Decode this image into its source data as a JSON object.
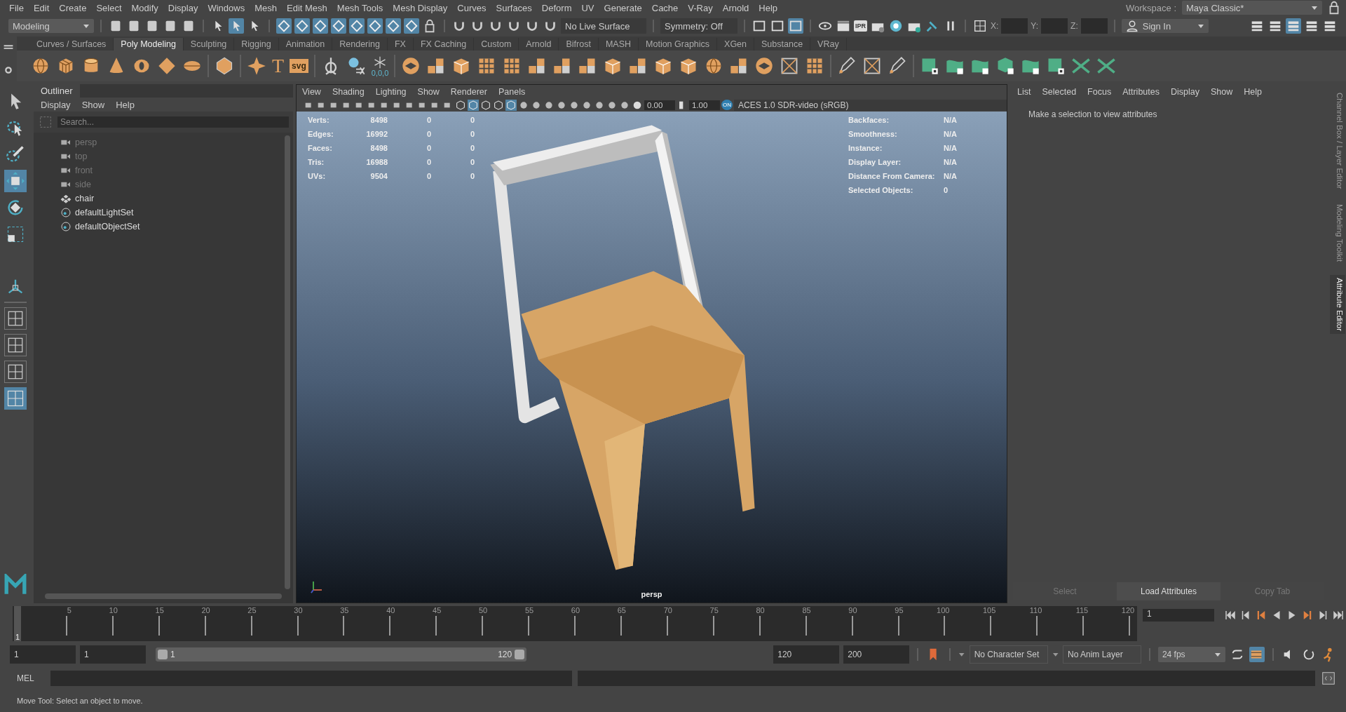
{
  "menu_bar": [
    "File",
    "Edit",
    "Create",
    "Select",
    "Modify",
    "Display",
    "Windows",
    "Mesh",
    "Edit Mesh",
    "Mesh Tools",
    "Mesh Display",
    "Curves",
    "Surfaces",
    "Deform",
    "UV",
    "Generate",
    "Cache",
    "V-Ray",
    "Arnold",
    "Help"
  ],
  "workspace": {
    "label": "Workspace :",
    "value": "Maya Classic*"
  },
  "status_line": {
    "mode": "Modeling",
    "select_modes": [
      {
        "selected": false
      },
      {
        "selected": true
      },
      {
        "selected": false
      }
    ],
    "mask_buttons": [
      {
        "on": true
      },
      {
        "on": true
      },
      {
        "on": true
      },
      {
        "on": true
      },
      {
        "on": true
      },
      {
        "on": true
      },
      {
        "on": true
      },
      {
        "on": true
      }
    ],
    "live_surface": "No Live Surface",
    "symmetry": "Symmetry: Off",
    "panel_toggles": [
      {
        "selected": false
      },
      {
        "selected": false
      },
      {
        "selected": true
      }
    ],
    "ipr_label": "IPR",
    "x_label": "X:",
    "y_label": "Y:",
    "z_label": "Z:",
    "sign_in": "Sign In",
    "layout_toggles": [
      {
        "selected": false
      },
      {
        "selected": false
      },
      {
        "selected": true
      },
      {
        "selected": false
      },
      {
        "selected": false
      }
    ]
  },
  "shelf": {
    "tabs": [
      {
        "label": "Curves / Surfaces",
        "selected": false
      },
      {
        "label": "Poly Modeling",
        "selected": true
      },
      {
        "label": "Sculpting",
        "selected": false
      },
      {
        "label": "Rigging",
        "selected": false
      },
      {
        "label": "Animation",
        "selected": false
      },
      {
        "label": "Rendering",
        "selected": false
      },
      {
        "label": "FX",
        "selected": false
      },
      {
        "label": "FX Caching",
        "selected": false
      },
      {
        "label": "Custom",
        "selected": false
      },
      {
        "label": "Arnold",
        "selected": false
      },
      {
        "label": "Bifrost",
        "selected": false
      },
      {
        "label": "MASH",
        "selected": false
      },
      {
        "label": "Motion Graphics",
        "selected": false
      },
      {
        "label": "XGen",
        "selected": false
      },
      {
        "label": "Substance",
        "selected": false
      },
      {
        "label": "VRay",
        "selected": false
      }
    ],
    "text_tool_glyph": "T",
    "svg_tool_label": "svg",
    "snap_values": "0,0,0"
  },
  "toolbox": {
    "tools": [
      {
        "selected": false
      },
      {
        "selected": false
      },
      {
        "selected": false
      },
      {
        "selected": true
      },
      {
        "selected": false
      },
      {
        "selected": false
      }
    ],
    "layouts": [
      {
        "selected": false
      },
      {
        "selected": false
      },
      {
        "selected": false
      },
      {
        "selected": true
      }
    ]
  },
  "outliner": {
    "title": "Outliner",
    "menu": [
      "Display",
      "Show",
      "Help"
    ],
    "search": {
      "placeholder": "Search..."
    },
    "items": [
      {
        "label": "persp",
        "kind": "camera",
        "dimmed": true
      },
      {
        "label": "top",
        "kind": "camera",
        "dimmed": true
      },
      {
        "label": "front",
        "kind": "camera",
        "dimmed": true
      },
      {
        "label": "side",
        "kind": "camera",
        "dimmed": true
      },
      {
        "label": "chair",
        "kind": "mesh",
        "dimmed": false
      },
      {
        "label": "defaultLightSet",
        "kind": "set",
        "dimmed": false
      },
      {
        "label": "defaultObjectSet",
        "kind": "set",
        "dimmed": false
      }
    ]
  },
  "viewport": {
    "menu": [
      "View",
      "Shading",
      "Lighting",
      "Show",
      "Renderer",
      "Panels"
    ],
    "shading_buttons": [
      {
        "selected": false
      },
      {
        "selected": true
      },
      {
        "selected": false
      },
      {
        "selected": false
      },
      {
        "selected": true
      }
    ],
    "exposure": "0.00",
    "gamma": "1.00",
    "color_badge": "ON",
    "color_space": "ACES 1.0 SDR-video (sRGB)",
    "hud_left": [
      {
        "label": "Verts:",
        "values": [
          "8498",
          "0",
          "0"
        ]
      },
      {
        "label": "Edges:",
        "values": [
          "16992",
          "0",
          "0"
        ]
      },
      {
        "label": "Faces:",
        "values": [
          "8498",
          "0",
          "0"
        ]
      },
      {
        "label": "Tris:",
        "values": [
          "16988",
          "0",
          "0"
        ]
      },
      {
        "label": "UVs:",
        "values": [
          "9504",
          "0",
          "0"
        ]
      }
    ],
    "hud_right": [
      {
        "label": "Backfaces:",
        "value": "N/A"
      },
      {
        "label": "Smoothness:",
        "value": "N/A"
      },
      {
        "label": "Instance:",
        "value": "N/A"
      },
      {
        "label": "Display Layer:",
        "value": "N/A"
      },
      {
        "label": "Distance From Camera:",
        "value": "N/A"
      },
      {
        "label": "Selected Objects:",
        "value": "0"
      }
    ],
    "camera": "persp"
  },
  "attribute_editor": {
    "menu": [
      "List",
      "Selected",
      "Focus",
      "Attributes",
      "Display",
      "Show",
      "Help"
    ],
    "message": "Make a selection to view attributes",
    "buttons": [
      {
        "label": "Select",
        "disabled": true
      },
      {
        "label": "Load Attributes",
        "disabled": false
      },
      {
        "label": "Copy Tab",
        "disabled": true
      }
    ]
  },
  "side_tabs": [
    {
      "label": "Channel Box / Layer Editor",
      "selected": false
    },
    {
      "label": "Modeling Toolkit",
      "selected": false
    },
    {
      "label": "Attribute Editor",
      "selected": true
    }
  ],
  "timeline": {
    "current_frame": "1",
    "ticks": [
      "5",
      "10",
      "15",
      "20",
      "25",
      "30",
      "35",
      "40",
      "45",
      "50",
      "55",
      "60",
      "65",
      "70",
      "75",
      "80",
      "85",
      "90",
      "95",
      "100",
      "105",
      "110",
      "115",
      "120"
    ],
    "frame_field": "1"
  },
  "range": {
    "start": "1",
    "playback_start": "1",
    "slider_start": "1",
    "slider_end": "120",
    "playback_end": "120",
    "end": "200",
    "character_set": "No Character Set",
    "anim_layer": "No Anim Layer",
    "fps": "24 fps",
    "level": 1,
    "loop_on": false,
    "cache_on": true
  },
  "command_line": {
    "label": "MEL"
  },
  "help_line": "Move Tool: Select an object to move."
}
